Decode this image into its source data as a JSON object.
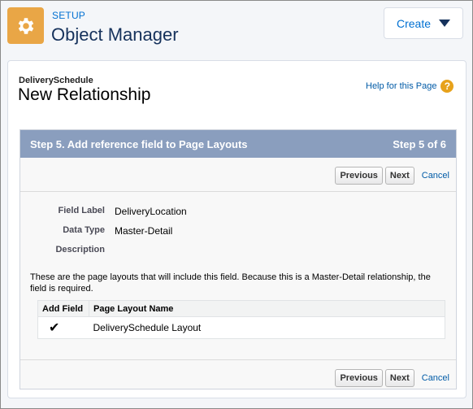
{
  "header": {
    "setup_label": "SETUP",
    "title": "Object Manager",
    "create_label": "Create",
    "icon": "gear-icon",
    "accent": "#e9a646"
  },
  "panel": {
    "object_name": "DeliverySchedule",
    "page_title": "New Relationship",
    "help_label": "Help for this Page",
    "help_glyph": "?"
  },
  "wizard": {
    "step_title": "Step 5. Add reference field to Page Layouts",
    "step_count": "Step 5 of 6",
    "previous_label": "Previous",
    "next_label": "Next",
    "cancel_label": "Cancel",
    "header_color": "#8a9ebe"
  },
  "fields": [
    {
      "label": "Field Label",
      "value": "DeliveryLocation"
    },
    {
      "label": "Data Type",
      "value": "Master-Detail"
    },
    {
      "label": "Description",
      "value": ""
    }
  ],
  "info_text": "These are the page layouts that will include this field. Because this is a Master-Detail relationship, the field is required.",
  "table": {
    "columns": [
      "Add Field",
      "Page Layout Name"
    ],
    "rows": [
      {
        "checked_glyph": "✔",
        "name": "DeliverySchedule Layout"
      }
    ]
  }
}
